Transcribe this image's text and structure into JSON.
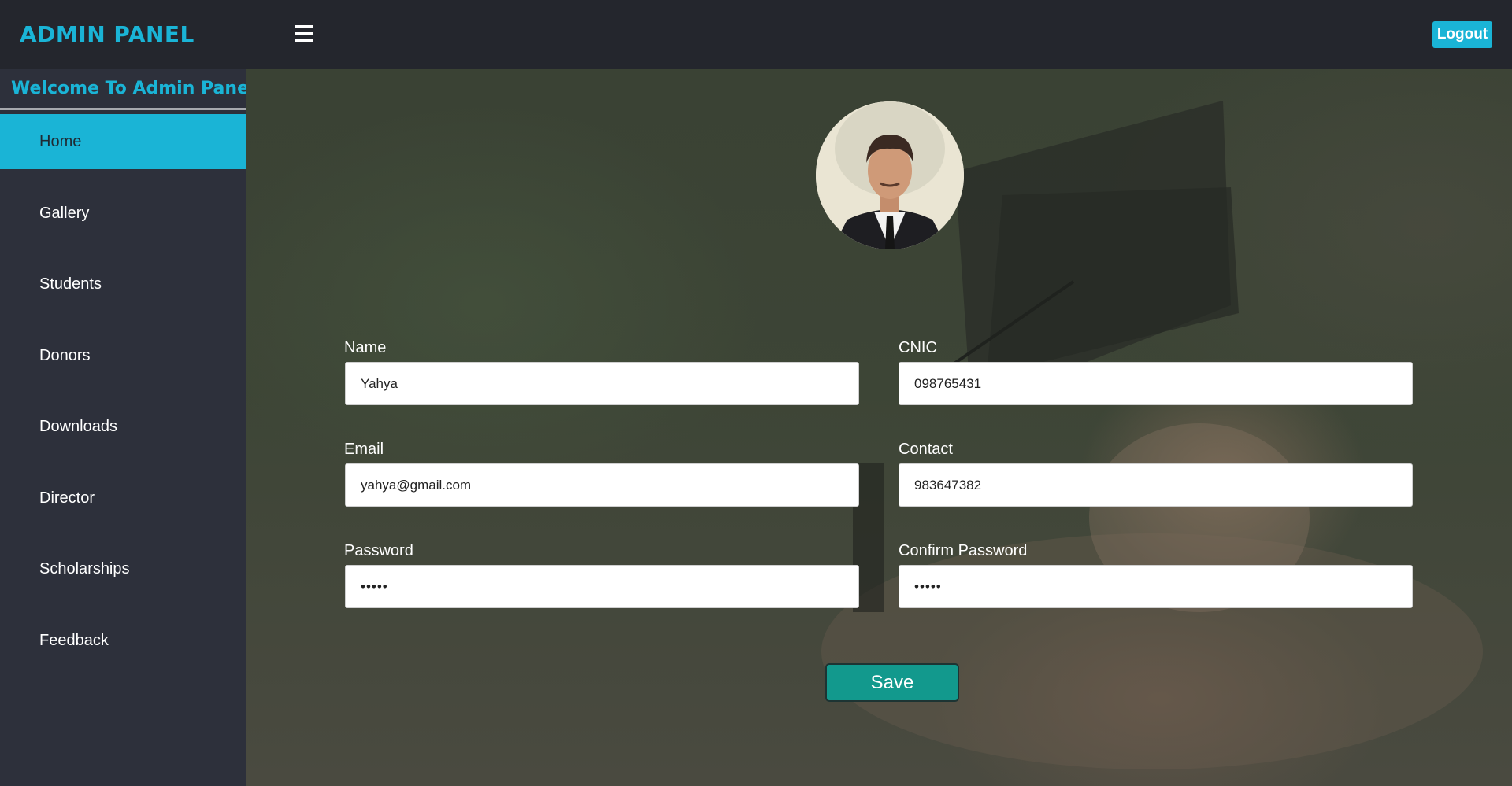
{
  "header": {
    "brand": "ADMIN PANEL",
    "menu_icon": "hamburger-menu-icon",
    "logout_label": "Logout"
  },
  "sidebar": {
    "welcome": "Welcome To Admin Panel",
    "items": [
      {
        "label": "Home",
        "active": true
      },
      {
        "label": "Gallery",
        "active": false
      },
      {
        "label": "Students",
        "active": false
      },
      {
        "label": "Donors",
        "active": false
      },
      {
        "label": "Downloads",
        "active": false
      },
      {
        "label": "Director",
        "active": false
      },
      {
        "label": "Scholarships",
        "active": false
      },
      {
        "label": "Feedback",
        "active": false
      }
    ]
  },
  "form": {
    "name": {
      "label": "Name",
      "value": "Yahya"
    },
    "cnic": {
      "label": "CNIC",
      "value": "098765431"
    },
    "email": {
      "label": "Email",
      "value": "yahya@gmail.com"
    },
    "contact": {
      "label": "Contact",
      "value": "983647382"
    },
    "password": {
      "label": "Password",
      "value": "•••••"
    },
    "confirm_password": {
      "label": "Confirm Password",
      "value": "•••••"
    },
    "save_label": "Save"
  },
  "colors": {
    "accent": "#1ab4d6",
    "topbar": "#24262d",
    "sidebar": "#2d303b",
    "save_button": "#12998d"
  }
}
